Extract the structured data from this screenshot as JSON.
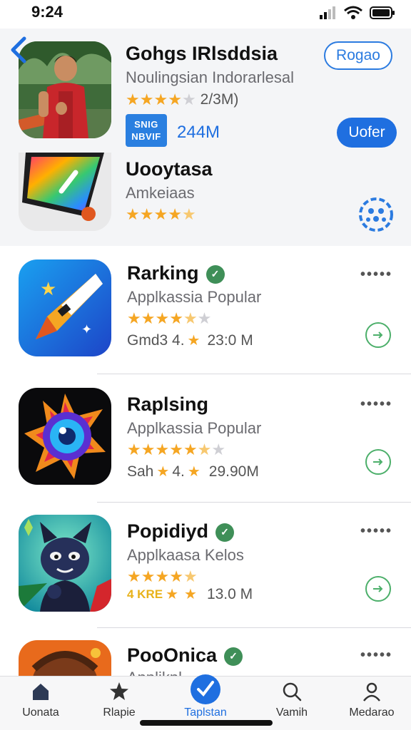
{
  "status_bar": {
    "time": "9:24"
  },
  "featured": {
    "title": "Gohgs IRlsddsia",
    "subtitle": "Noulingsian Indorarlesal",
    "rating_text": "2/3M)",
    "badge": [
      "SNIG",
      "NBVIF"
    ],
    "size": "244M",
    "primary_button": "Rogao",
    "secondary_button": "Uofer"
  },
  "second_app": {
    "title": "Uooytasa",
    "subtitle": "Amkeiaas"
  },
  "apps": [
    {
      "title": "Rarking",
      "subtitle": "Applkassia Popular",
      "meta_left": "Gmd3 4.",
      "size": "23:0 M"
    },
    {
      "title": "Raplsing",
      "subtitle": "Applkassia Popular",
      "meta_left": "Sah",
      "meta_mid": "4.",
      "size": "29.90M"
    },
    {
      "title": "Popidiyd",
      "subtitle": "Applkaasa Kelos",
      "meta_left": "4 KRE",
      "size": "13.0 M"
    },
    {
      "title": "PooOnica",
      "subtitle": "Applikpl"
    }
  ],
  "tabs": [
    {
      "label": "Uonata",
      "icon": "home-icon"
    },
    {
      "label": "Rlapie",
      "icon": "star-icon"
    },
    {
      "label": "Taplstan",
      "icon": "apps-icon"
    },
    {
      "label": "Vamih",
      "icon": "search-icon"
    },
    {
      "label": "Medarao",
      "icon": "profile-icon"
    }
  ],
  "colors": {
    "accent": "#1f6fe0",
    "star": "#f5a623",
    "verified": "#3f8f58",
    "go": "#4caf6a"
  }
}
